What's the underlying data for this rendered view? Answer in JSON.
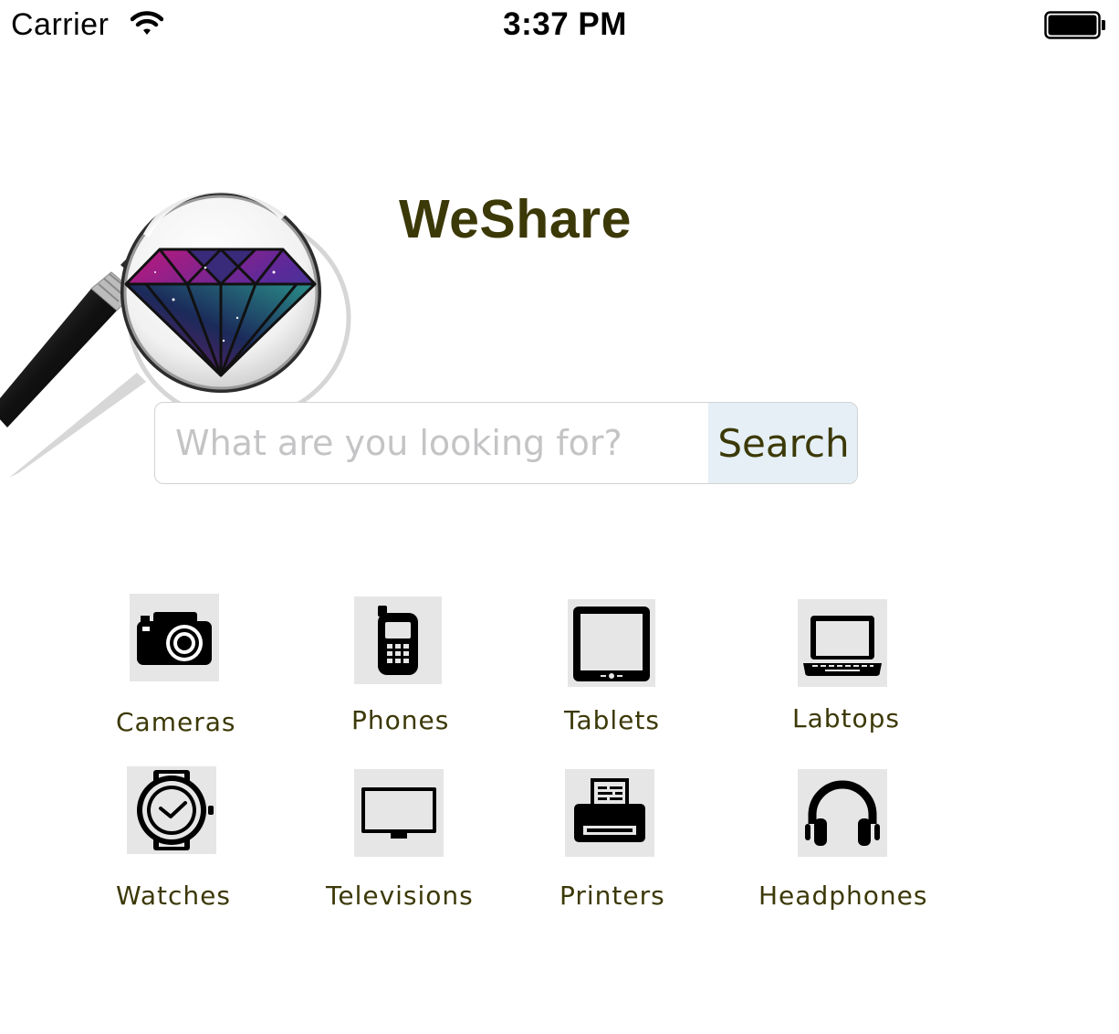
{
  "status_bar": {
    "carrier": "Carrier",
    "time": "3:37 PM"
  },
  "app": {
    "title": "WeShare",
    "title_color": "#3c3908"
  },
  "search": {
    "placeholder": "What are you looking for?",
    "value": "",
    "button_label": "Search",
    "button_bg": "#e5eff5"
  },
  "categories": [
    {
      "label": "Cameras",
      "icon": "camera-icon"
    },
    {
      "label": "Phones",
      "icon": "phone-icon"
    },
    {
      "label": "Tablets",
      "icon": "tablet-icon"
    },
    {
      "label": "Labtops",
      "icon": "laptop-icon"
    },
    {
      "label": "Watches",
      "icon": "watch-icon"
    },
    {
      "label": "Televisions",
      "icon": "television-icon"
    },
    {
      "label": "Printers",
      "icon": "printer-icon"
    },
    {
      "label": "Headphones",
      "icon": "headphones-icon"
    }
  ]
}
